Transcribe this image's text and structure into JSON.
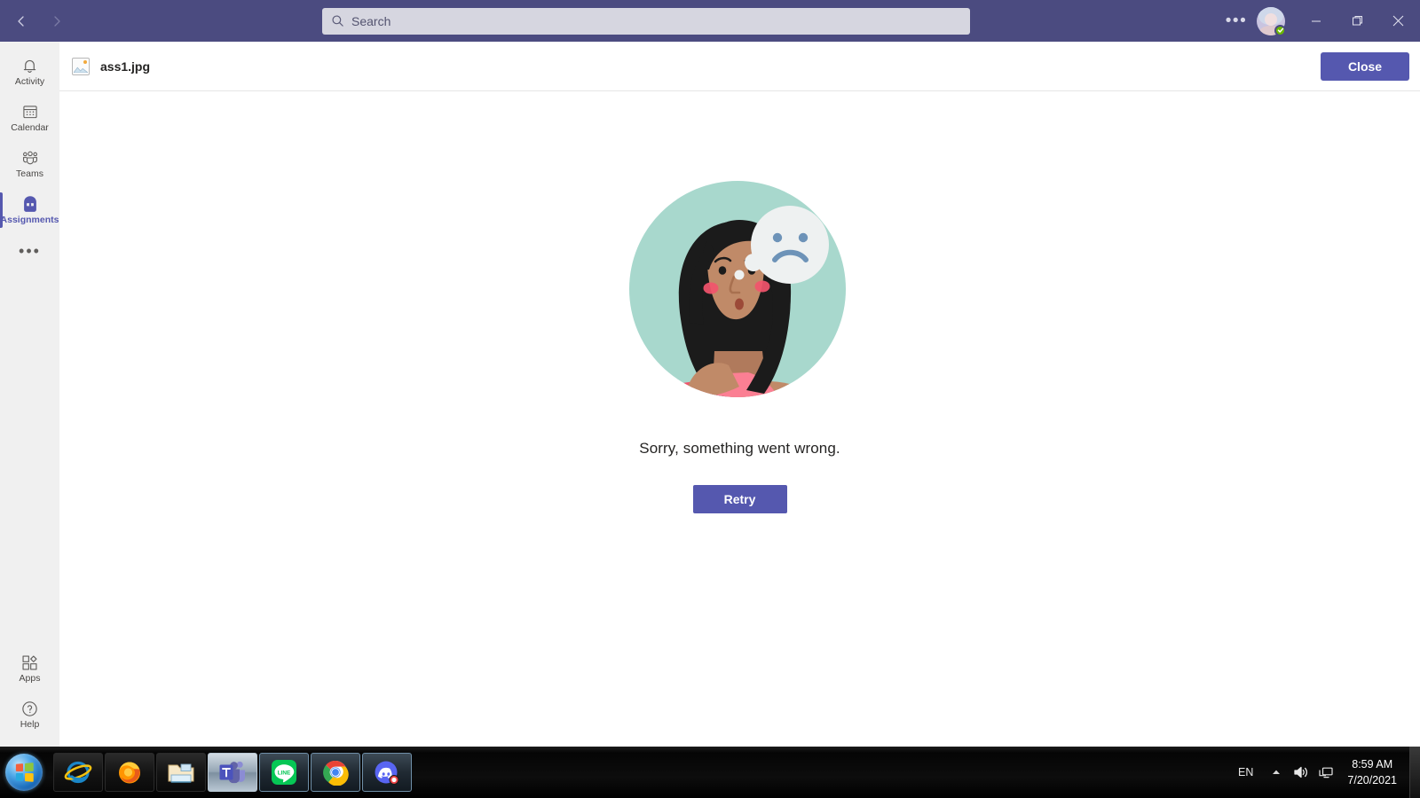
{
  "titlebar": {
    "back_icon": "chevron-left-icon",
    "forward_icon": "chevron-right-icon",
    "search_placeholder": "Search",
    "search_value": "",
    "search_icon": "search-icon",
    "more_options_label": "•••",
    "presence_status": "Available",
    "minimize_icon": "minimize-icon",
    "maximize_icon": "maximize-icon",
    "close_icon": "close-icon"
  },
  "rail": {
    "items": [
      {
        "label": "Activity",
        "icon": "bell-icon",
        "active": false
      },
      {
        "label": "Calendar",
        "icon": "calendar-icon",
        "active": false
      },
      {
        "label": "Teams",
        "icon": "people-icon",
        "active": false
      },
      {
        "label": "Assignments",
        "icon": "backpack-icon",
        "active": true
      }
    ],
    "more_label": "•••",
    "bottom_items": [
      {
        "label": "Apps",
        "icon": "apps-grid-icon"
      },
      {
        "label": "Help",
        "icon": "question-circle-icon"
      }
    ]
  },
  "content_header": {
    "file_icon": "image-file-icon",
    "file_name": "ass1.jpg",
    "close_label": "Close"
  },
  "error_pane": {
    "illustration": "person-thinking-sad-thought-bubble",
    "message": "Sorry, something went wrong.",
    "retry_label": "Retry"
  },
  "taskbar": {
    "start_icon": "windows-start-orb",
    "buttons": [
      {
        "name": "internet-explorer",
        "state": "pinned"
      },
      {
        "name": "firefox",
        "state": "pinned"
      },
      {
        "name": "file-explorer",
        "state": "pinned"
      },
      {
        "name": "microsoft-teams",
        "state": "active"
      },
      {
        "name": "line",
        "state": "running"
      },
      {
        "name": "google-chrome",
        "state": "running"
      },
      {
        "name": "discord",
        "state": "running"
      }
    ],
    "tray": {
      "language": "EN",
      "overflow_icon": "chevron-up-icon",
      "volume_icon": "speaker-icon",
      "network_icon": "network-icon",
      "time": "8:59 AM",
      "date": "7/20/2021"
    }
  },
  "colors": {
    "accent": "#5558af",
    "titlebar": "#4b4b80",
    "rail_bg": "#f0f0f0",
    "presence_green": "#6bb700",
    "illustration_bg": "#a8d8cd",
    "illustration_shirt": "#f96d82",
    "illustration_hair": "#1b1b1b"
  }
}
